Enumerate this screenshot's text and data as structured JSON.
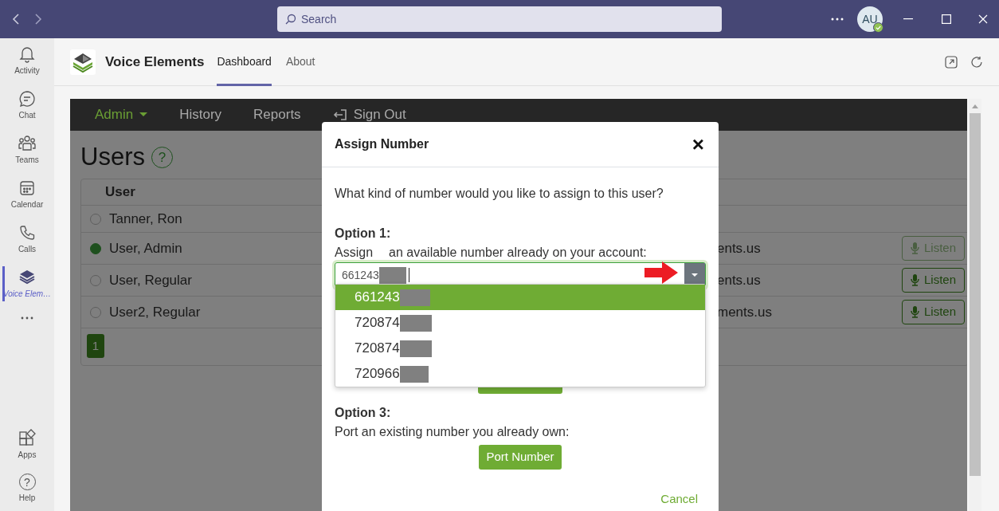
{
  "title_bar": {
    "search": {
      "placeholder": "Search"
    },
    "avatar": {
      "initials": "AU"
    }
  },
  "rail": {
    "items": [
      {
        "label": "Activity",
        "kind": "bell",
        "selected": false
      },
      {
        "label": "Chat",
        "kind": "chat",
        "selected": false
      },
      {
        "label": "Teams",
        "kind": "teams",
        "selected": false
      },
      {
        "label": "Calendar",
        "kind": "calendar",
        "selected": false
      },
      {
        "label": "Calls",
        "kind": "calls",
        "selected": false
      },
      {
        "label": "Voice Elem…",
        "kind": "app",
        "selected": true
      }
    ],
    "bottom_items": [
      {
        "label": "Apps",
        "kind": "apps"
      },
      {
        "label": "Help",
        "kind": "help",
        "glyph": "?"
      }
    ]
  },
  "app_header": {
    "name": "Voice Elements",
    "tabs": [
      {
        "label": "Dashboard",
        "selected": true
      },
      {
        "label": "About",
        "selected": false
      }
    ]
  },
  "nav": {
    "items": [
      {
        "label": "Admin",
        "kind": "dropdown",
        "selected": true
      },
      {
        "label": "History",
        "kind": "link",
        "selected": false
      },
      {
        "label": "Reports",
        "kind": "link",
        "selected": false
      },
      {
        "label": "Sign Out",
        "kind": "signout",
        "selected": false
      }
    ]
  },
  "page": {
    "title": "Users",
    "help_glyph": "?",
    "table": {
      "columns": [
        "User"
      ],
      "rows": [
        {
          "name": "Tanner, Ron",
          "selected": false
        },
        {
          "name": "User, Admin",
          "selected": true,
          "email_fragment": "ents.us",
          "listen": {
            "label": "Listen",
            "disabled": true
          }
        },
        {
          "name": "User, Regular",
          "selected": false,
          "email_fragment": "ents.us",
          "listen": {
            "label": "Listen",
            "disabled": false
          }
        },
        {
          "name": "User2, Regular",
          "selected": false,
          "email_fragment": "ments.us",
          "listen": {
            "label": "Listen",
            "disabled": false
          }
        }
      ]
    },
    "pagination": [
      {
        "label": "1",
        "selected": true
      }
    ]
  },
  "modal": {
    "title": "Assign Number",
    "close": "×",
    "intro": "What kind of number would you like to assign to this user?",
    "option1": {
      "heading": "Option 1:",
      "text_parts": [
        "Assign",
        "an available number already on your account:"
      ],
      "value": "661243",
      "options": [
        {
          "label": "661243",
          "selected": true
        },
        {
          "label": "720874",
          "selected": false
        },
        {
          "label": "720874",
          "selected": false
        },
        {
          "label": "720966",
          "selected": false
        }
      ]
    },
    "option3": {
      "heading": "Option 3:",
      "text": "Port an existing number you already own:",
      "button": "Port Number"
    },
    "cancel": "Cancel"
  }
}
